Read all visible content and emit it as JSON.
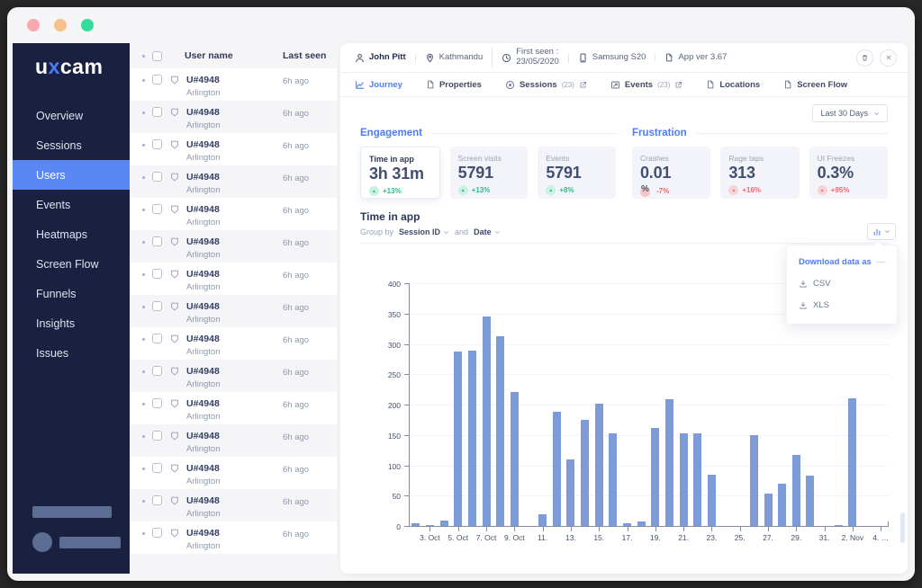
{
  "colors": {
    "accent": "#4d7cf6",
    "bar": "#7d9bd9",
    "good": "#27c088",
    "bad": "#ef6a70",
    "sidebar_bg": "#1a2140",
    "selection": "#5b87f2"
  },
  "window": {
    "traffic_lights": [
      "#f9a8b0",
      "#f7c08c",
      "#35dd9d"
    ]
  },
  "sidebar": {
    "logo_prefix": "u",
    "logo_accent": "x",
    "logo_suffix": "cam",
    "items": [
      {
        "label": "Overview"
      },
      {
        "label": "Sessions"
      },
      {
        "label": "Users",
        "active": true
      },
      {
        "label": "Events"
      },
      {
        "label": "Heatmaps"
      },
      {
        "label": "Screen Flow"
      },
      {
        "label": "Funnels"
      },
      {
        "label": "Insights"
      },
      {
        "label": "Issues"
      }
    ]
  },
  "user_list": {
    "columns": {
      "user": "User name",
      "seen": "Last seen"
    },
    "rows": [
      {
        "id": "U#4948",
        "city": "Arlington",
        "last_seen": "6h ago"
      },
      {
        "id": "U#4948",
        "city": "Arlington",
        "last_seen": "6h ago"
      },
      {
        "id": "U#4948",
        "city": "Arlington",
        "last_seen": "6h ago"
      },
      {
        "id": "U#4948",
        "city": "Arlington",
        "last_seen": "6h ago"
      },
      {
        "id": "U#4948",
        "city": "Arlington",
        "last_seen": "6h ago"
      },
      {
        "id": "U#4948",
        "city": "Arlington",
        "last_seen": "6h ago"
      },
      {
        "id": "U#4948",
        "city": "Arlington",
        "last_seen": "6h ago"
      },
      {
        "id": "U#4948",
        "city": "Arlington",
        "last_seen": "6h ago"
      },
      {
        "id": "U#4948",
        "city": "Arlington",
        "last_seen": "6h ago"
      },
      {
        "id": "U#4948",
        "city": "Arlington",
        "last_seen": "6h ago"
      },
      {
        "id": "U#4948",
        "city": "Arlington",
        "last_seen": "6h ago"
      },
      {
        "id": "U#4948",
        "city": "Arlington",
        "last_seen": "6h ago"
      },
      {
        "id": "U#4948",
        "city": "Arlington",
        "last_seen": "6h ago"
      },
      {
        "id": "U#4948",
        "city": "Arlington",
        "last_seen": "6h ago"
      },
      {
        "id": "U#4948",
        "city": "Arlington",
        "last_seen": "6h ago"
      }
    ]
  },
  "detail": {
    "meta": [
      {
        "icon": "person",
        "text": "John Pitt",
        "bold": true
      },
      {
        "icon": "map-pin",
        "text": "Kathmandu"
      },
      {
        "icon": "clock",
        "text": "First seen :",
        "sub": "23/05/2020"
      },
      {
        "icon": "phone",
        "text": "Samsung S20"
      },
      {
        "icon": "file",
        "text": "App ver 3.67"
      }
    ],
    "tabs": [
      {
        "label": "Journey",
        "icon": "line-chart",
        "active": true
      },
      {
        "label": "Properties",
        "icon": "file"
      },
      {
        "label": "Sessions",
        "icon": "circle-dot",
        "count": "(23)",
        "external": true
      },
      {
        "label": "Events",
        "icon": "card-arrow",
        "count": "(23)",
        "external": true
      },
      {
        "label": "Locations",
        "icon": "file"
      },
      {
        "label": "Screen Flow",
        "icon": "file"
      }
    ],
    "date_range": "Last 30 Days",
    "groups": [
      {
        "title": "Engagement",
        "cards": [
          {
            "label": "Time in app",
            "value": "3h 31m",
            "delta": "+13%",
            "tone": "good",
            "active": true
          },
          {
            "label": "Screen visits",
            "value": "5791",
            "delta": "+13%",
            "tone": "good"
          },
          {
            "label": "Events",
            "value": "5791",
            "delta": "+8%",
            "tone": "good"
          }
        ]
      },
      {
        "title": "Frustration",
        "cards": [
          {
            "label": "Crashes",
            "value": "0.01",
            "delta": "-7%",
            "tone": "bad",
            "badge": "percent"
          },
          {
            "label": "Rage taps",
            "value": "313",
            "delta": "+16%",
            "tone": "bad"
          },
          {
            "label": "UI Freezes",
            "value": "0.3%",
            "delta": "+95%",
            "tone": "bad"
          }
        ]
      }
    ],
    "chart_header": {
      "title": "Time in app",
      "group_by": "Group by",
      "field1": "Session ID",
      "and": "and",
      "field2": "Date"
    },
    "download_menu": {
      "title": "Download data as",
      "options": [
        {
          "icon": "download",
          "label": "CSV"
        },
        {
          "icon": "download",
          "label": "XLS"
        }
      ]
    }
  },
  "chart_data": {
    "type": "bar",
    "title": "Time in app",
    "xlabel": "",
    "ylabel": "",
    "ylim": [
      0,
      400
    ],
    "ytick_step": 50,
    "grid": true,
    "legend": false,
    "bar_color": "#7d9bd9",
    "x": [
      "2 Oct",
      "3 Oct",
      "4 Oct",
      "5 Oct",
      "6 Oct",
      "7 Oct",
      "8 Oct",
      "9 Oct",
      "10 Oct",
      "11 Oct",
      "12 Oct",
      "13 Oct",
      "14 Oct",
      "15 Oct",
      "16 Oct",
      "17 Oct",
      "18 Oct",
      "19 Oct",
      "20 Oct",
      "21 Oct",
      "22 Oct",
      "23 Oct",
      "24 Oct",
      "25 Oct",
      "26 Oct",
      "27 Oct",
      "28 Oct",
      "29 Oct",
      "30 Oct",
      "31 Oct",
      "1 Nov",
      "2 Nov",
      "3 Nov"
    ],
    "values": [
      4,
      2,
      9,
      287,
      289,
      345,
      313,
      221,
      0,
      20,
      188,
      110,
      175,
      201,
      153,
      4,
      8,
      162,
      209,
      152,
      152,
      85,
      0,
      0,
      150,
      53,
      69,
      117,
      83,
      0,
      2,
      211,
      0
    ],
    "slots": 34,
    "xticks": [
      {
        "i": 1,
        "label": "3. Oct"
      },
      {
        "i": 3,
        "label": "5. Oct"
      },
      {
        "i": 5,
        "label": "7. Oct"
      },
      {
        "i": 7,
        "label": "9. Oct"
      },
      {
        "i": 9,
        "label": "11."
      },
      {
        "i": 11,
        "label": "13."
      },
      {
        "i": 13,
        "label": "15."
      },
      {
        "i": 15,
        "label": "17."
      },
      {
        "i": 17,
        "label": "19."
      },
      {
        "i": 19,
        "label": "21."
      },
      {
        "i": 21,
        "label": "23."
      },
      {
        "i": 23,
        "label": "25."
      },
      {
        "i": 25,
        "label": "27."
      },
      {
        "i": 27,
        "label": "29."
      },
      {
        "i": 29,
        "label": "31."
      },
      {
        "i": 31,
        "label": "2. Nov"
      },
      {
        "i": 33,
        "label": "4. …"
      }
    ]
  }
}
